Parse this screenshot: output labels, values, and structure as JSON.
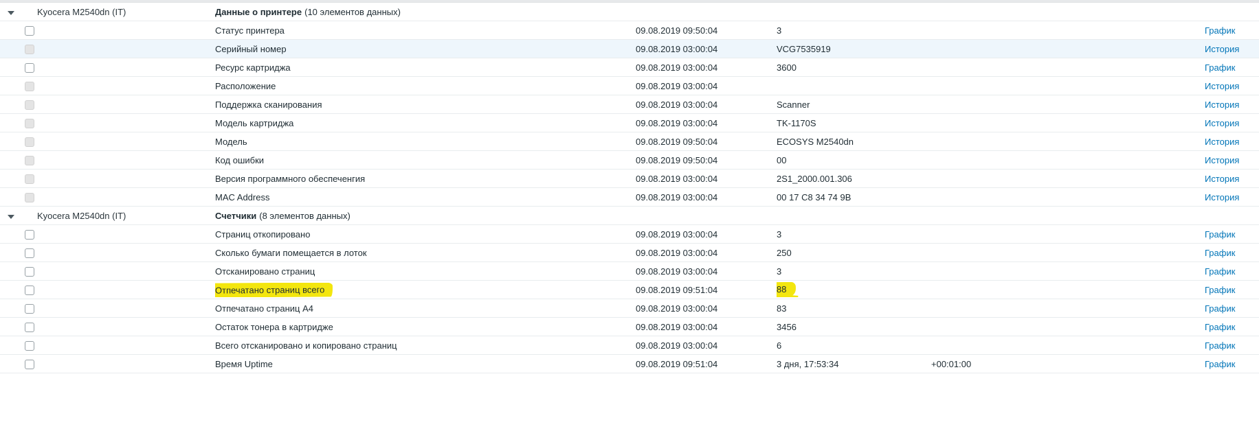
{
  "table": {
    "groups": [
      {
        "host": "Kyocera M2540dn (IT)",
        "application": "Данные о принтере",
        "count": "(10 элементов данных)",
        "items": [
          {
            "name": "Статус принтера",
            "last_check": "09.08.2019 09:50:04",
            "last_value": "3",
            "change": "",
            "link": "График",
            "checkbox": "enabled"
          },
          {
            "name": "Серийный номер",
            "last_check": "09.08.2019 03:00:04",
            "last_value": "VCG7535919",
            "change": "",
            "link": "История",
            "checkbox": "disabled",
            "row_selected": true
          },
          {
            "name": "Ресурс картриджа",
            "last_check": "09.08.2019 03:00:04",
            "last_value": "3600",
            "change": "",
            "link": "График",
            "checkbox": "enabled"
          },
          {
            "name": "Расположение",
            "last_check": "09.08.2019 03:00:04",
            "last_value": "",
            "change": "",
            "link": "История",
            "checkbox": "disabled"
          },
          {
            "name": "Поддержка сканирования",
            "last_check": "09.08.2019 03:00:04",
            "last_value": "Scanner",
            "change": "",
            "link": "История",
            "checkbox": "disabled"
          },
          {
            "name": "Модель картриджа",
            "last_check": "09.08.2019 03:00:04",
            "last_value": "TK-1170S",
            "change": "",
            "link": "История",
            "checkbox": "disabled"
          },
          {
            "name": "Модель",
            "last_check": "09.08.2019 09:50:04",
            "last_value": "ECOSYS M2540dn",
            "change": "",
            "link": "История",
            "checkbox": "disabled"
          },
          {
            "name": "Код ошибки",
            "last_check": "09.08.2019 09:50:04",
            "last_value": "00",
            "change": "",
            "link": "История",
            "checkbox": "disabled"
          },
          {
            "name": "Версия программного обеспеченгия",
            "last_check": "09.08.2019 03:00:04",
            "last_value": "2S1_2000.001.306",
            "change": "",
            "link": "История",
            "checkbox": "disabled"
          },
          {
            "name": "MAC Address",
            "last_check": "09.08.2019 03:00:04",
            "last_value": "00 17 C8 34 74 9B",
            "change": "",
            "link": "История",
            "checkbox": "disabled"
          }
        ]
      },
      {
        "host": "Kyocera M2540dn (IT)",
        "application": "Счетчики",
        "count": "(8 элементов данных)",
        "items": [
          {
            "name": "Страниц откопировано",
            "last_check": "09.08.2019 03:00:04",
            "last_value": "3",
            "change": "",
            "link": "График",
            "checkbox": "enabled"
          },
          {
            "name": "Сколько бумаги помещается в лоток",
            "last_check": "09.08.2019 03:00:04",
            "last_value": "250",
            "change": "",
            "link": "График",
            "checkbox": "enabled"
          },
          {
            "name": "Отсканировано страниц",
            "last_check": "09.08.2019 03:00:04",
            "last_value": "3",
            "change": "",
            "link": "График",
            "checkbox": "enabled"
          },
          {
            "name": "Отпечатано страниц всего",
            "last_check": "09.08.2019 09:51:04",
            "last_value": "88",
            "change": "",
            "link": "График",
            "checkbox": "enabled",
            "highlight_name": true,
            "highlight_value": true
          },
          {
            "name": "Отпечатано страниц A4",
            "last_check": "09.08.2019 03:00:04",
            "last_value": "83",
            "change": "",
            "link": "График",
            "checkbox": "enabled"
          },
          {
            "name": "Остаток тонера в картридже",
            "last_check": "09.08.2019 03:00:04",
            "last_value": "3456",
            "change": "",
            "link": "График",
            "checkbox": "enabled"
          },
          {
            "name": "Всего отсканировано и копировано страниц",
            "last_check": "09.08.2019 03:00:04",
            "last_value": "6",
            "change": "",
            "link": "График",
            "checkbox": "enabled"
          },
          {
            "name": "Время Uptime",
            "last_check": "09.08.2019 09:51:04",
            "last_value": "3 дня, 17:53:34",
            "change": "+00:01:00",
            "link": "График",
            "checkbox": "enabled"
          }
        ]
      }
    ]
  },
  "colors": {
    "link": "#0275b8",
    "selected_row_bg": "#eef6fc",
    "highlighter_yellow": "#f3e60e",
    "text": "#1f2c33",
    "row_border": "#e8ecee"
  }
}
